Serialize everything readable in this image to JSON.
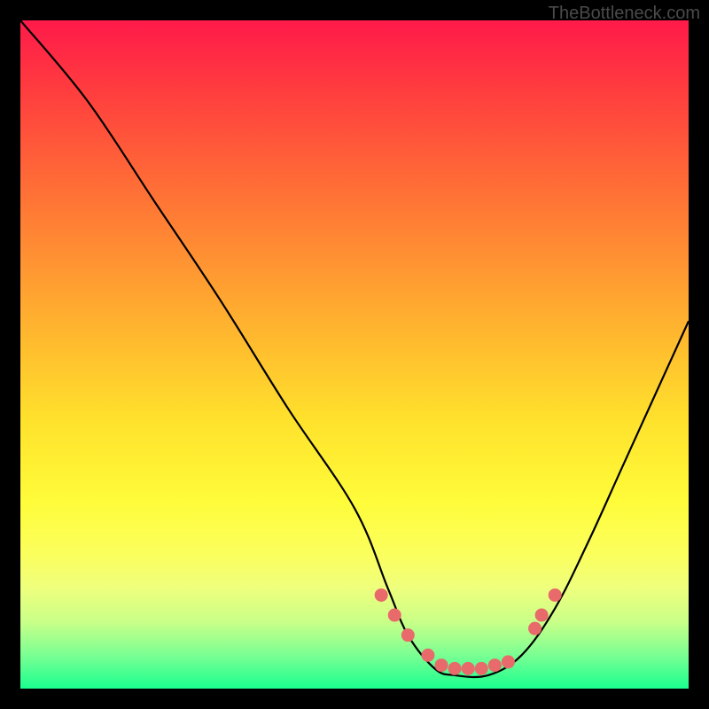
{
  "watermark": "TheBottleneck.com",
  "chart_data": {
    "type": "line",
    "title": "",
    "xlabel": "",
    "ylabel": "",
    "xlim": [
      0,
      100
    ],
    "ylim": [
      0,
      100
    ],
    "series": [
      {
        "name": "curve",
        "x": [
          0,
          10,
          20,
          30,
          40,
          50,
          55,
          58,
          62,
          65,
          70,
          75,
          80,
          85,
          90,
          95,
          100
        ],
        "values": [
          100,
          88,
          73,
          58,
          42,
          27,
          15,
          8,
          3,
          2,
          2,
          5,
          12,
          22,
          33,
          44,
          55
        ]
      }
    ],
    "markers": {
      "name": "dots",
      "color": "#e86a6a",
      "x": [
        54,
        56,
        58,
        61,
        63,
        65,
        67,
        69,
        71,
        73,
        77,
        78,
        80
      ],
      "values": [
        14,
        11,
        8,
        5,
        3.5,
        3,
        3,
        3,
        3.5,
        4,
        9,
        11,
        14
      ]
    },
    "gradient_stops": [
      {
        "pos": 0,
        "color": "#ff1a4a"
      },
      {
        "pos": 10,
        "color": "#ff3b3f"
      },
      {
        "pos": 25,
        "color": "#ff6e36"
      },
      {
        "pos": 45,
        "color": "#ffb12f"
      },
      {
        "pos": 60,
        "color": "#ffe22c"
      },
      {
        "pos": 72,
        "color": "#fffc3a"
      },
      {
        "pos": 80,
        "color": "#fbff5e"
      },
      {
        "pos": 85,
        "color": "#efff7d"
      },
      {
        "pos": 90,
        "color": "#c9ff88"
      },
      {
        "pos": 95,
        "color": "#7aff93"
      },
      {
        "pos": 100,
        "color": "#1aff8f"
      }
    ]
  }
}
